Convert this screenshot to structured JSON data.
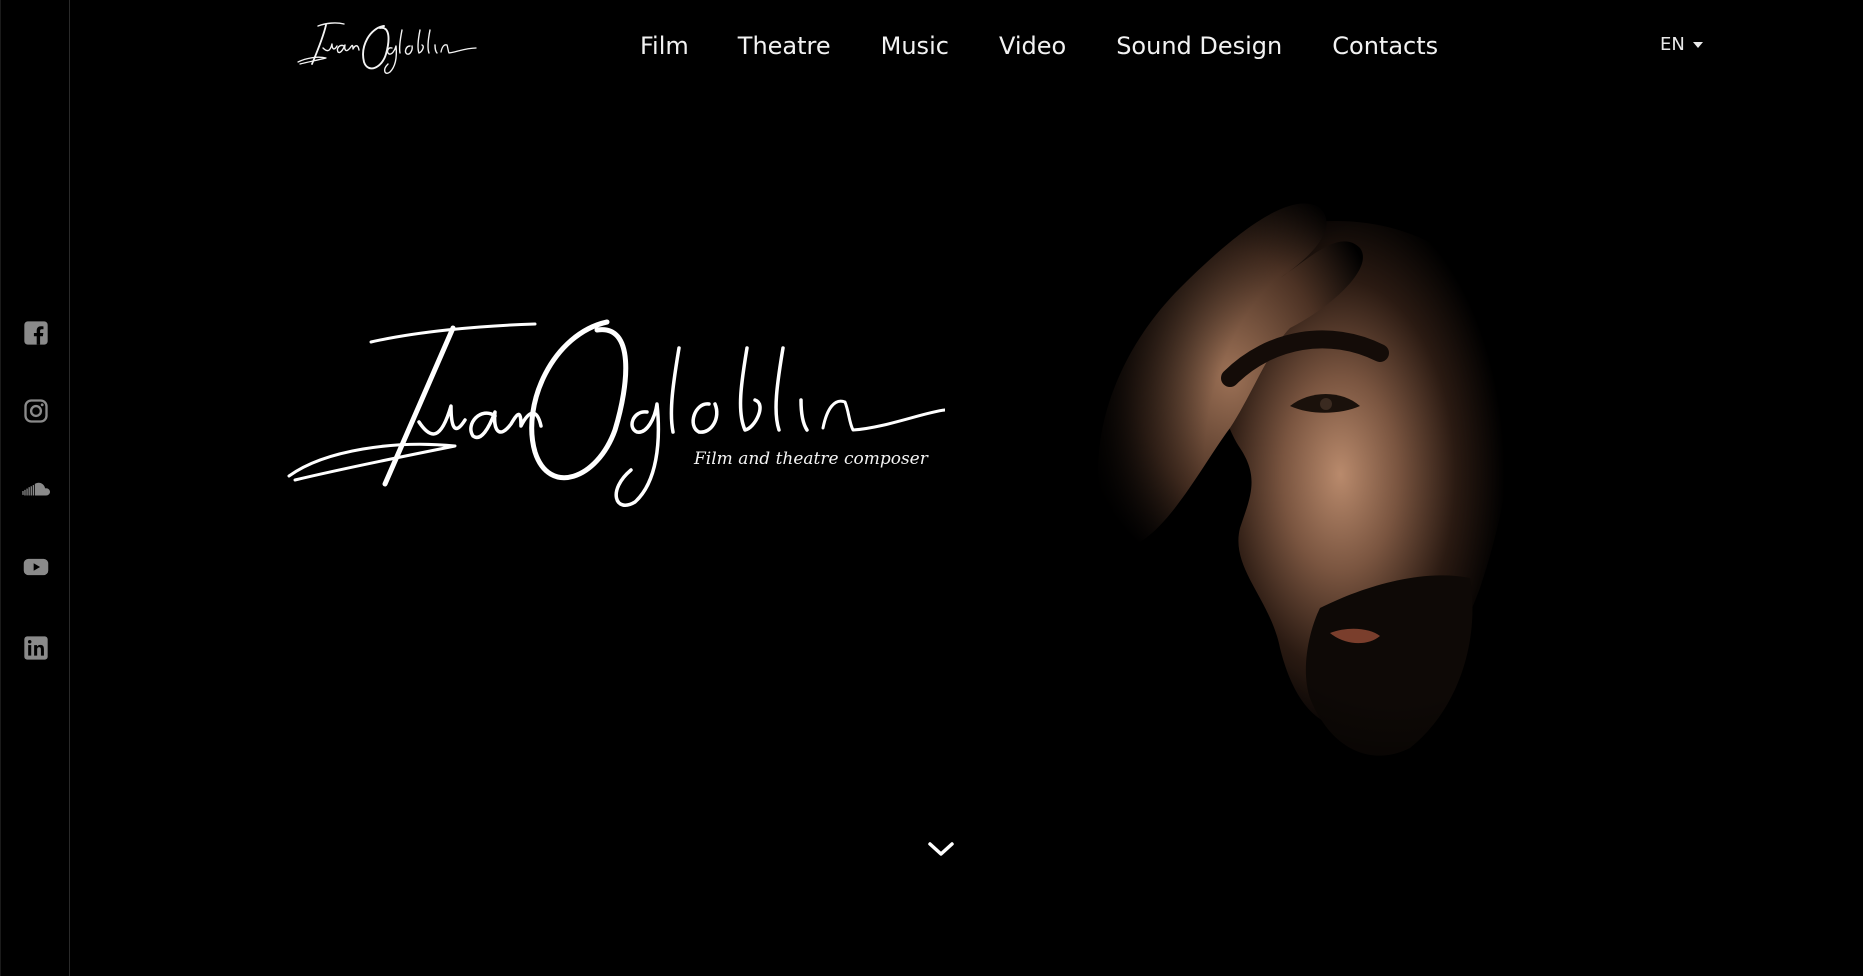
{
  "header": {
    "logo_text": "Ivan Ogloblin",
    "language": "EN"
  },
  "nav": {
    "items": [
      {
        "label": "Film"
      },
      {
        "label": "Theatre"
      },
      {
        "label": "Music"
      },
      {
        "label": "Video"
      },
      {
        "label": "Sound Design"
      },
      {
        "label": "Contacts"
      }
    ]
  },
  "hero": {
    "name": "Ivan Ogloblin",
    "subtitle": "Film and theatre composer"
  },
  "social": {
    "icons": [
      "facebook-icon",
      "instagram-icon",
      "soundcloud-icon",
      "youtube-icon",
      "linkedin-icon"
    ]
  },
  "colors": {
    "background": "#000000",
    "text": "#ffffff",
    "icon": "#8a8a8a"
  }
}
